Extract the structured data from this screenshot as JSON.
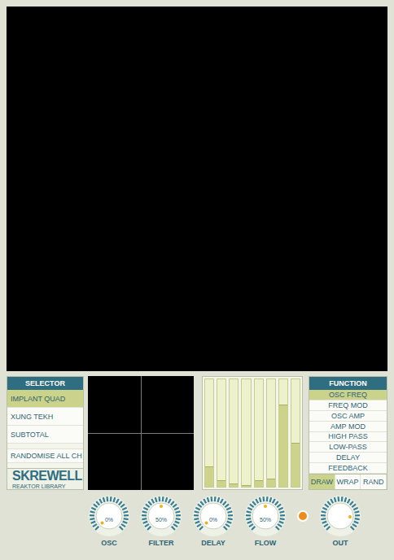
{
  "visual": {
    "kind": "picture"
  },
  "selector": {
    "title": "SELECTOR",
    "items": [
      {
        "label": "IMPLANT QUAD",
        "selected": true
      },
      {
        "label": "XUNG TEKH",
        "selected": false
      },
      {
        "label": "SUBTOTAL",
        "selected": false
      }
    ],
    "randomise": "RANDOMISE ALL CH"
  },
  "logo": {
    "name": "SKREWELL",
    "subtitle": "REAKTOR LIBRARY"
  },
  "xy_pad": {
    "x": 0.5,
    "y": 0.5
  },
  "bars": [
    {
      "level": 0.18
    },
    {
      "level": 0.05
    },
    {
      "level": 0.02
    },
    {
      "level": 0.01
    },
    {
      "level": 0.05
    },
    {
      "level": 0.07
    },
    {
      "level": 0.76
    },
    {
      "level": 0.4
    }
  ],
  "function": {
    "title": "FUNCTION",
    "items": [
      {
        "label": "OSC FREQ",
        "selected": true
      },
      {
        "label": "FREQ MOD",
        "selected": false
      },
      {
        "label": "OSC AMP",
        "selected": false
      },
      {
        "label": "AMP MOD",
        "selected": false
      },
      {
        "label": "HIGH PASS",
        "selected": false
      },
      {
        "label": "LOW-PASS",
        "selected": false
      },
      {
        "label": "DELAY",
        "selected": false
      },
      {
        "label": "FEEDBACK",
        "selected": false
      }
    ],
    "modes": [
      {
        "label": "DRAW",
        "selected": true
      },
      {
        "label": "WRAP",
        "selected": false
      },
      {
        "label": "RAND",
        "selected": false
      }
    ]
  },
  "knobs": [
    {
      "label": "OSC",
      "reading": "0%",
      "level": 0
    },
    {
      "label": "FILTER",
      "reading": "50%",
      "level": 0.5
    },
    {
      "label": "DELAY",
      "reading": "0%",
      "level": 0
    },
    {
      "label": "FLOW",
      "reading": "50%",
      "level": 0.5
    }
  ],
  "indicator": {
    "on": true
  },
  "out_knob": {
    "label": "OUT",
    "level": 0.85
  }
}
